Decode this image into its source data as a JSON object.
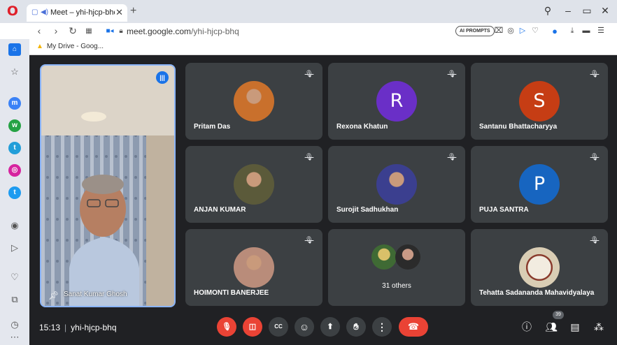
{
  "browser": {
    "tab_title": "Meet – yhi-hjcp-bhq",
    "tab_close": "✕",
    "new_tab": "+",
    "url_host": "meet.google.com",
    "url_path": "/yhi-hjcp-bhq",
    "ai_prompts_label": "AI PROMPTS",
    "bookmark_label": "My Drive - Goog..."
  },
  "meeting": {
    "time": "15:13",
    "code": "yhi-hjcp-bhq",
    "participant_count": "39",
    "speaker": {
      "name": "Sanat Kumar Ghosh"
    },
    "tiles": [
      {
        "name": "Pritam Das",
        "kind": "photo",
        "color": "#c9702c"
      },
      {
        "name": "Rexona Khatun",
        "kind": "initial",
        "initial": "R",
        "color": "#6a2fc7"
      },
      {
        "name": "Santanu Bhattacharyya",
        "kind": "initial",
        "initial": "S",
        "color": "#c63d14"
      },
      {
        "name": "ANJAN KUMAR",
        "kind": "photo",
        "color": "#5b5a3a"
      },
      {
        "name": "Surojit Sadhukhan",
        "kind": "photo",
        "color": "#3b3f8f"
      },
      {
        "name": "PUJA SANTRA",
        "kind": "initial",
        "initial": "P",
        "color": "#1765c0"
      },
      {
        "name": "HOIMONTI BANERJEE",
        "kind": "photo",
        "color": "#b98c7a"
      },
      {
        "name": "31 others",
        "kind": "group",
        "color": "#5a6b3b"
      },
      {
        "name": "Tehatta Sadananda Mahavidyalaya",
        "kind": "logo",
        "color": "#d9cdb4"
      }
    ]
  },
  "controls": {
    "mic": "mic-off",
    "camera": "camera-off",
    "captions_label": "CC",
    "emoji": "emoji",
    "present": "present",
    "raise_hand": "raise-hand",
    "more": "more",
    "leave": "leave-call"
  },
  "colors": {
    "meet_bg": "#202124",
    "tile_bg": "#3c4043",
    "danger": "#ea4335",
    "accent": "#1a73e8"
  }
}
